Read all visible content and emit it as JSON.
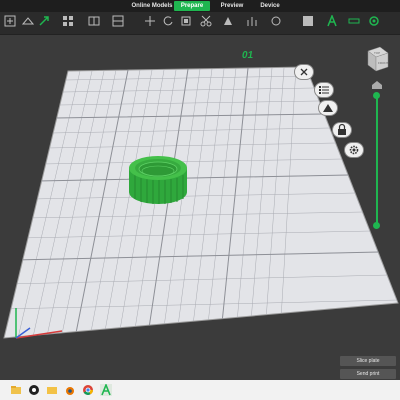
{
  "nav": {
    "tabs": [
      {
        "label": "Online Models",
        "active": false
      },
      {
        "label": "Prepare",
        "active": true
      },
      {
        "label": "Preview",
        "active": false
      },
      {
        "label": "Device",
        "active": false
      }
    ]
  },
  "toolbar": {
    "icons": [
      "add-icon",
      "add-plate-icon",
      "orient-icon",
      "arrange-icon",
      "split-icon",
      "layout-icon",
      "separator",
      "move-icon",
      "rotate-icon",
      "scale-icon",
      "cut-icon",
      "paint-icon",
      "support-icon",
      "seam-icon",
      "text-icon",
      "measure-icon"
    ]
  },
  "viewport": {
    "plate_label": "01",
    "accent": "#1fb650",
    "cube_labels": [
      "TOP",
      "FRONT"
    ]
  },
  "actions": {
    "slice": "Slice plate",
    "send": "Send print"
  },
  "taskbar": {
    "icons": [
      "file-explorer-icon",
      "github-icon",
      "folder-icon",
      "blender-icon",
      "chrome-icon",
      "bambu-studio-icon"
    ]
  }
}
